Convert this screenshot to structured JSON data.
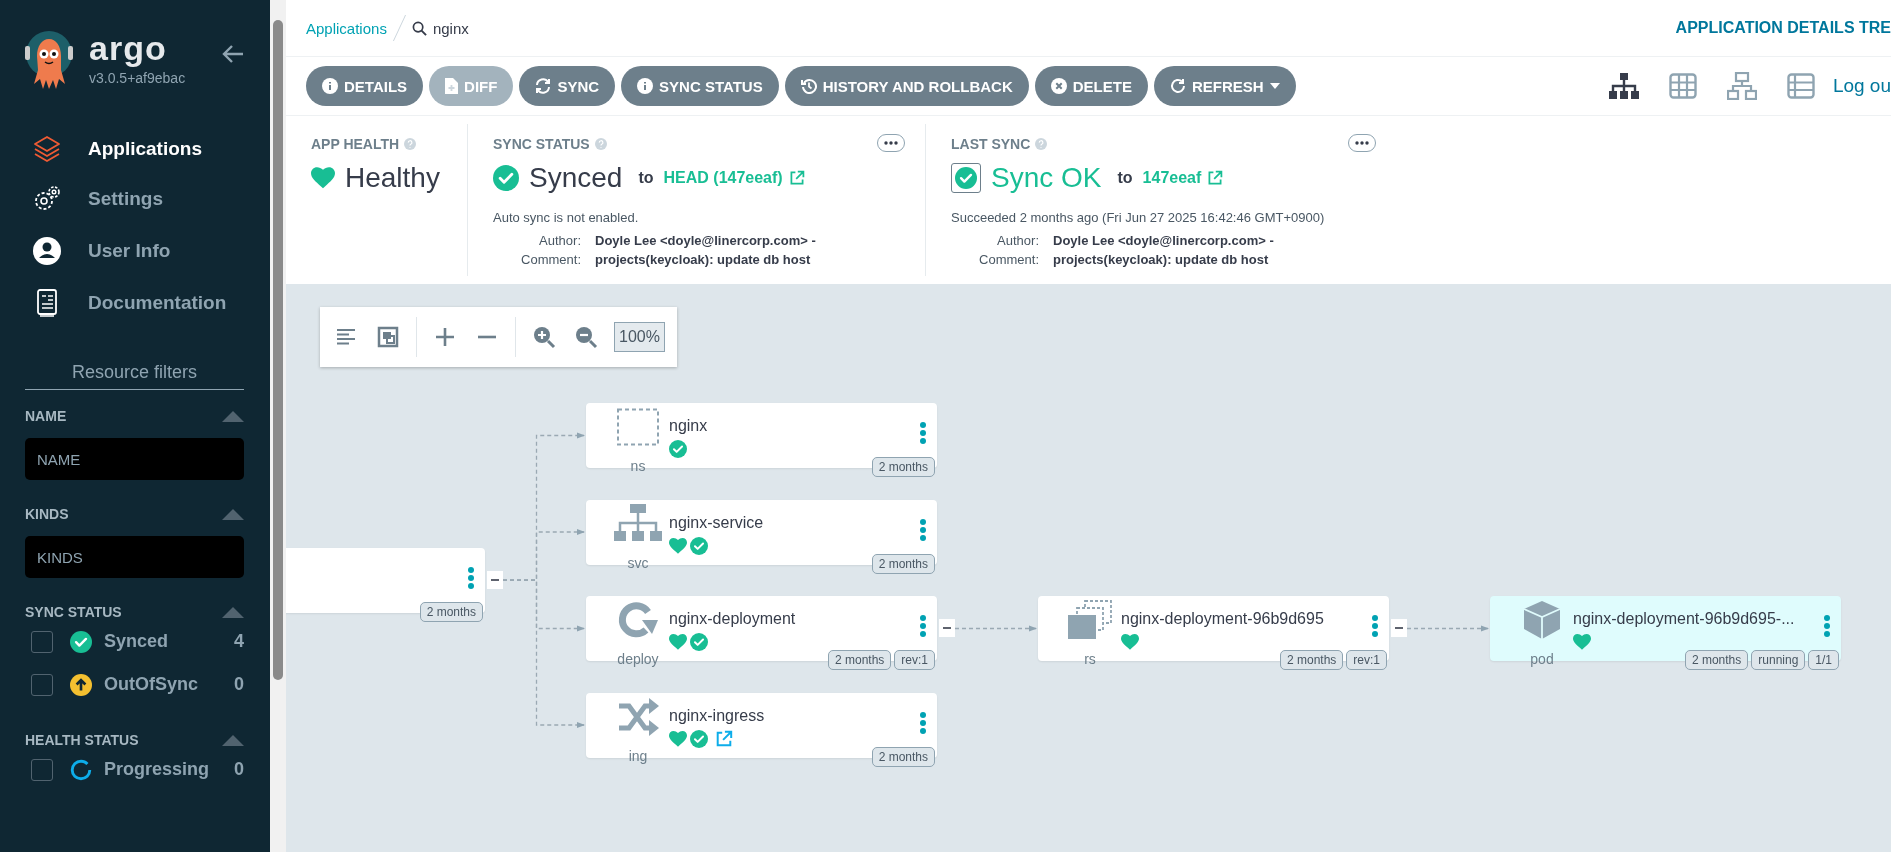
{
  "sidebar": {
    "logo_text": "argo",
    "version": "v3.0.5+af9ebac",
    "nav": [
      {
        "label": "Applications",
        "selected": true
      },
      {
        "label": "Settings",
        "selected": false
      },
      {
        "label": "User Info",
        "selected": false
      },
      {
        "label": "Documentation",
        "selected": false
      }
    ],
    "filters_title": "Resource filters",
    "filters": [
      {
        "kind": "text",
        "title": "NAME",
        "placeholder": "NAME"
      },
      {
        "kind": "text",
        "title": "KINDS",
        "placeholder": "KINDS"
      },
      {
        "kind": "checklist",
        "title": "SYNC STATUS",
        "options": [
          {
            "label": "Synced",
            "count": "4",
            "checked": false,
            "kind": "synced"
          },
          {
            "label": "OutOfSync",
            "count": "0",
            "checked": false,
            "kind": "outofsync"
          }
        ]
      },
      {
        "kind": "checklist",
        "title": "HEALTH STATUS",
        "options": [
          {
            "label": "Progressing",
            "count": "0",
            "checked": false,
            "kind": "progressing"
          }
        ]
      }
    ]
  },
  "breadcrumbs": [
    {
      "label": "Applications"
    }
  ],
  "current_app": "nginx",
  "page_title": "APPLICATION DETAILS TRE",
  "actions": [
    {
      "label": "DETAILS",
      "disabled": false,
      "dropdown": false
    },
    {
      "label": "DIFF",
      "disabled": true,
      "dropdown": false
    },
    {
      "label": "SYNC",
      "disabled": false,
      "dropdown": false
    },
    {
      "label": "SYNC STATUS",
      "disabled": false,
      "dropdown": false
    },
    {
      "label": "HISTORY AND ROLLBACK",
      "disabled": false,
      "dropdown": false
    },
    {
      "label": "DELETE",
      "disabled": false,
      "dropdown": false
    },
    {
      "label": "REFRESH",
      "disabled": false,
      "dropdown": true
    }
  ],
  "view_modes": [
    {
      "selected": true
    },
    {
      "selected": false
    },
    {
      "selected": false
    },
    {
      "selected": false
    }
  ],
  "logout": "Log ou",
  "app_health": {
    "title": "APP HEALTH",
    "value": "Healthy"
  },
  "sync_status": {
    "title": "SYNC STATUS",
    "value": "Synced",
    "to": "to",
    "revision": "HEAD (147eeaf)",
    "note": "Auto sync is not enabled.",
    "author_label": "Author:",
    "author": "Doyle Lee <doyle@linercorp.com> -",
    "comment_label": "Comment:",
    "comment": "projects(keycloak): update db host"
  },
  "last_sync": {
    "title": "LAST SYNC",
    "value": "Sync OK",
    "to": "to",
    "revision": "147eeaf",
    "note": "Succeeded 2 months ago (Fri Jun 27 2025 16:42:46 GMT+0900)",
    "author_label": "Author:",
    "author": "Doyle Lee <doyle@linercorp.com> -",
    "comment_label": "Comment:",
    "comment": "projects(keycloak): update db host"
  },
  "graph": {
    "zoom": "100%",
    "root": {
      "badges": [
        "2 months"
      ],
      "expanded": true,
      "children": [
        {
          "kind": "ns",
          "name": "nginx",
          "healthy": false,
          "synced": true,
          "link": false,
          "selected": false,
          "badges": [
            "2 months"
          ]
        },
        {
          "kind": "svc",
          "name": "nginx-service",
          "healthy": true,
          "synced": true,
          "link": false,
          "selected": false,
          "badges": [
            "2 months"
          ]
        },
        {
          "kind": "deploy",
          "name": "nginx-deployment",
          "healthy": true,
          "synced": true,
          "link": false,
          "selected": false,
          "badges": [
            "2 months",
            "rev:1"
          ],
          "expanded": true,
          "children": [
            {
              "kind": "rs",
              "name": "nginx-deployment-96b9d695",
              "healthy": true,
              "synced": false,
              "link": false,
              "selected": false,
              "badges": [
                "2 months",
                "rev:1"
              ],
              "expanded": true,
              "children": [
                {
                  "kind": "pod",
                  "name": "nginx-deployment-96b9d695-...",
                  "healthy": true,
                  "synced": false,
                  "link": false,
                  "selected": true,
                  "badges": [
                    "2 months",
                    "running",
                    "1/1"
                  ]
                }
              ]
            }
          ]
        },
        {
          "kind": "ing",
          "name": "nginx-ingress",
          "healthy": true,
          "synced": true,
          "link": true,
          "selected": false,
          "badges": [
            "2 months"
          ]
        }
      ]
    }
  }
}
